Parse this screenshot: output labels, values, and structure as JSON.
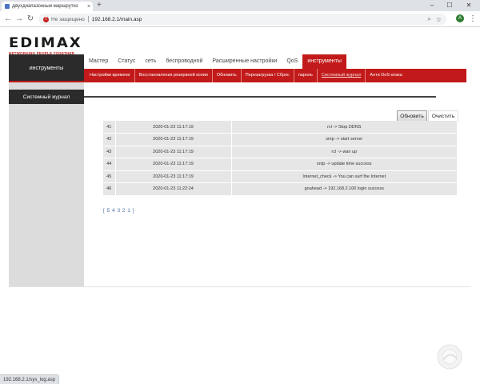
{
  "browser": {
    "tab_title": "Двухдиапазонный маршрутиз",
    "tab_close": "×",
    "new_tab": "+",
    "address": {
      "security_label": "Не защищено",
      "url": "192.168.2.1/main.asp"
    },
    "account_initial": "A",
    "window_controls": {
      "minimize": "–",
      "maximize": "☐",
      "close": "✕"
    }
  },
  "logo": {
    "word": "EDIMAX",
    "tagline": "NETWORKING PEOPLE TOGETHER"
  },
  "sidebar": {
    "header": "инструменты",
    "section": "Системный журнал"
  },
  "top_nav": [
    {
      "label": "Мастер",
      "active": false
    },
    {
      "label": "Статус",
      "active": false
    },
    {
      "label": "сеть",
      "active": false
    },
    {
      "label": "беспроводной",
      "active": false
    },
    {
      "label": "Расширенные настройки",
      "active": false
    },
    {
      "label": "QoS",
      "active": false
    },
    {
      "label": "инструменты",
      "active": true
    }
  ],
  "sub_nav": [
    {
      "label": "Настройки времени",
      "current": false
    },
    {
      "label": "Восстановления резервной копии",
      "current": false
    },
    {
      "label": "Обновить",
      "current": false
    },
    {
      "label": "Перезагрузка / Сброс",
      "current": false
    },
    {
      "label": "пароль",
      "current": false
    },
    {
      "label": "Системный журнал",
      "current": true
    },
    {
      "label": "Анти DoS-атака",
      "current": false
    }
  ],
  "actions": {
    "refresh": "Обновить",
    "clear": "Очистить"
  },
  "log": {
    "rows": [
      {
        "id": "41",
        "time": "2020-01-23 11:17:19",
        "message": "rcl -> Stop DDNS"
      },
      {
        "id": "42",
        "time": "2020-01-23 11:17:19",
        "message": "smp -> start server"
      },
      {
        "id": "43",
        "time": "2020-01-23 11:17:19",
        "message": "rcl -> wan up"
      },
      {
        "id": "44",
        "time": "2020-01-23 11:17:19",
        "message": "sntp -> update time success"
      },
      {
        "id": "45",
        "time": "2020-01-23 11:17:19",
        "message": "Internet_check -> You can surf the Internet"
      },
      {
        "id": "46",
        "time": "2020-01-23 11:22:24",
        "message": "goahead -> 192.168.2.100 login success"
      }
    ]
  },
  "pagination": "[ 5 4 3 2 1 ]",
  "status_bar": "192.168.2.1/sys_log.asp",
  "colors": {
    "brand_red": "#c21a1a",
    "dark_header": "#2b2b2b",
    "sidebar_gray": "#dcdcdc",
    "row_gray": "#e6e6e6",
    "link_blue": "#4a6fa5"
  }
}
